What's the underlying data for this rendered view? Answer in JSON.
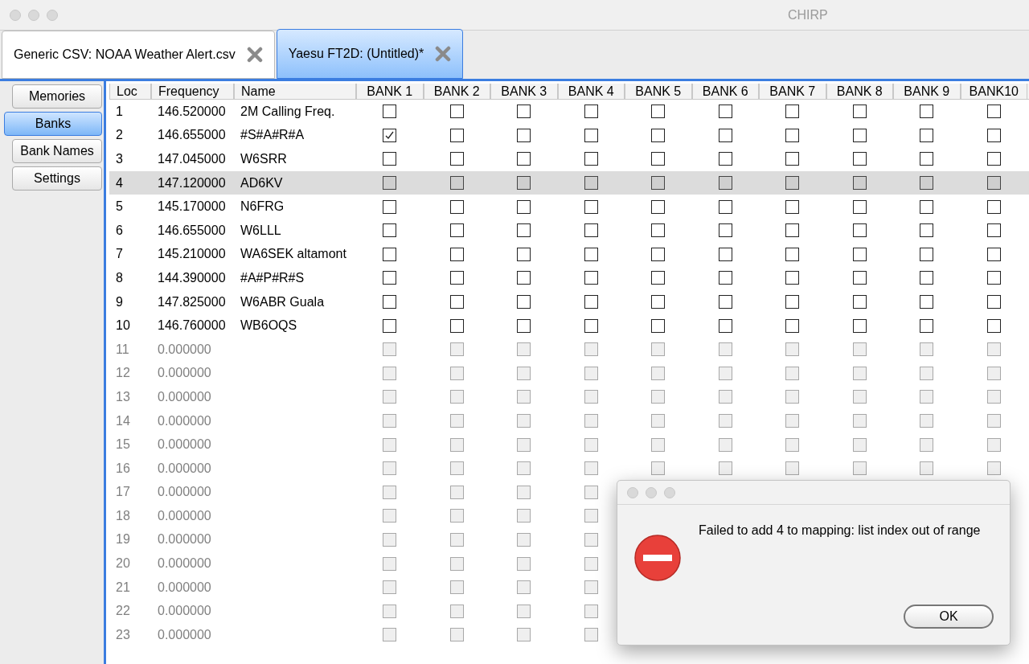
{
  "window": {
    "title": "CHIRP"
  },
  "tabs": [
    {
      "label": "Generic CSV: NOAA Weather Alert.csv",
      "selected": false
    },
    {
      "label": "Yaesu FT2D: (Untitled)*",
      "selected": true
    }
  ],
  "sidebar": {
    "items": [
      {
        "label": "Memories",
        "selected": false
      },
      {
        "label": "Banks",
        "selected": true
      },
      {
        "label": "Bank Names",
        "selected": false
      },
      {
        "label": "Settings",
        "selected": false
      }
    ]
  },
  "table": {
    "columns": [
      "Loc",
      "Frequency",
      "Name",
      "BANK 1",
      "BANK 2",
      "BANK 3",
      "BANK 4",
      "BANK 5",
      "BANK 6",
      "BANK 7",
      "BANK 8",
      "BANK 9",
      "BANK10"
    ],
    "rows": [
      {
        "loc": "1",
        "frequency": "146.520000",
        "name": "2M Calling Freq.",
        "selected": false,
        "disabled": false,
        "banks": [
          false,
          false,
          false,
          false,
          false,
          false,
          false,
          false,
          false,
          false
        ]
      },
      {
        "loc": "2",
        "frequency": "146.655000",
        "name": "#S#A#R#A",
        "selected": false,
        "disabled": false,
        "banks": [
          true,
          false,
          false,
          false,
          false,
          false,
          false,
          false,
          false,
          false
        ]
      },
      {
        "loc": "3",
        "frequency": "147.045000",
        "name": "W6SRR",
        "selected": false,
        "disabled": false,
        "banks": [
          false,
          false,
          false,
          false,
          false,
          false,
          false,
          false,
          false,
          false
        ]
      },
      {
        "loc": "4",
        "frequency": "147.120000",
        "name": "AD6KV",
        "selected": true,
        "disabled": false,
        "banks": [
          false,
          false,
          false,
          false,
          false,
          false,
          false,
          false,
          false,
          false
        ]
      },
      {
        "loc": "5",
        "frequency": "145.170000",
        "name": "N6FRG",
        "selected": false,
        "disabled": false,
        "banks": [
          false,
          false,
          false,
          false,
          false,
          false,
          false,
          false,
          false,
          false
        ]
      },
      {
        "loc": "6",
        "frequency": "146.655000",
        "name": "W6LLL",
        "selected": false,
        "disabled": false,
        "banks": [
          false,
          false,
          false,
          false,
          false,
          false,
          false,
          false,
          false,
          false
        ]
      },
      {
        "loc": "7",
        "frequency": "145.210000",
        "name": "WA6SEK altamont",
        "selected": false,
        "disabled": false,
        "banks": [
          false,
          false,
          false,
          false,
          false,
          false,
          false,
          false,
          false,
          false
        ]
      },
      {
        "loc": "8",
        "frequency": "144.390000",
        "name": "#A#P#R#S",
        "selected": false,
        "disabled": false,
        "banks": [
          false,
          false,
          false,
          false,
          false,
          false,
          false,
          false,
          false,
          false
        ]
      },
      {
        "loc": "9",
        "frequency": "147.825000",
        "name": "W6ABR Guala",
        "selected": false,
        "disabled": false,
        "banks": [
          false,
          false,
          false,
          false,
          false,
          false,
          false,
          false,
          false,
          false
        ]
      },
      {
        "loc": "10",
        "frequency": "146.760000",
        "name": "WB6OQS",
        "selected": false,
        "disabled": false,
        "banks": [
          false,
          false,
          false,
          false,
          false,
          false,
          false,
          false,
          false,
          false
        ]
      },
      {
        "loc": "11",
        "frequency": "0.000000",
        "selected": false,
        "disabled": true,
        "banks": [
          false,
          false,
          false,
          false,
          false,
          false,
          false,
          false,
          false,
          false
        ]
      },
      {
        "loc": "12",
        "frequency": "0.000000",
        "selected": false,
        "disabled": true,
        "banks": [
          false,
          false,
          false,
          false,
          false,
          false,
          false,
          false,
          false,
          false
        ]
      },
      {
        "loc": "13",
        "frequency": "0.000000",
        "selected": false,
        "disabled": true,
        "banks": [
          false,
          false,
          false,
          false,
          false,
          false,
          false,
          false,
          false,
          false
        ]
      },
      {
        "loc": "14",
        "frequency": "0.000000",
        "selected": false,
        "disabled": true,
        "banks": [
          false,
          false,
          false,
          false,
          false,
          false,
          false,
          false,
          false,
          false
        ]
      },
      {
        "loc": "15",
        "frequency": "0.000000",
        "selected": false,
        "disabled": true,
        "banks": [
          false,
          false,
          false,
          false,
          false,
          false,
          false,
          false,
          false,
          false
        ]
      },
      {
        "loc": "16",
        "frequency": "0.000000",
        "selected": false,
        "disabled": true,
        "banks": [
          false,
          false,
          false,
          false,
          false,
          false,
          false,
          false,
          false,
          false
        ]
      },
      {
        "loc": "17",
        "frequency": "0.000000",
        "selected": false,
        "disabled": true,
        "banks": [
          false,
          false,
          false,
          false
        ]
      },
      {
        "loc": "18",
        "frequency": "0.000000",
        "selected": false,
        "disabled": true,
        "banks": [
          false,
          false,
          false,
          false
        ]
      },
      {
        "loc": "19",
        "frequency": "0.000000",
        "selected": false,
        "disabled": true,
        "banks": [
          false,
          false,
          false,
          false
        ]
      },
      {
        "loc": "20",
        "frequency": "0.000000",
        "selected": false,
        "disabled": true,
        "banks": [
          false,
          false,
          false,
          false
        ]
      },
      {
        "loc": "21",
        "frequency": "0.000000",
        "selected": false,
        "disabled": true,
        "banks": [
          false,
          false,
          false,
          false
        ]
      },
      {
        "loc": "22",
        "frequency": "0.000000",
        "selected": false,
        "disabled": true,
        "banks": [
          false,
          false,
          false,
          false
        ]
      },
      {
        "loc": "23",
        "frequency": "0.000000",
        "selected": false,
        "disabled": true,
        "banks": [
          false,
          false,
          false,
          false
        ]
      }
    ]
  },
  "dialog": {
    "message": "Failed to add 4 to mapping: list index out of range",
    "buttons": [
      "OK"
    ]
  }
}
